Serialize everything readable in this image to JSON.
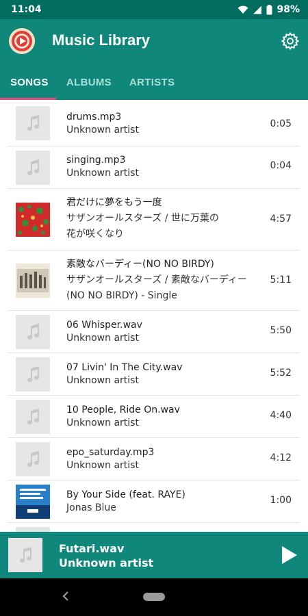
{
  "status_bar": {
    "time": "11:04",
    "battery": "98%"
  },
  "app_bar": {
    "title": "Music Library"
  },
  "tabs": [
    {
      "label": "SONGS"
    },
    {
      "label": "ALBUMS"
    },
    {
      "label": "ARTISTS"
    }
  ],
  "songs": [
    {
      "title": "drums.mp3",
      "artist": "Unknown artist",
      "duration": "0:05"
    },
    {
      "title": "singing.mp3",
      "artist": "Unknown artist",
      "duration": "0:04"
    },
    {
      "title": "君だけに夢をもう一度",
      "artist": "サザンオールスターズ / 世に万葉の",
      "artist2": "花が咲くなり",
      "duration": "4:57"
    },
    {
      "title": "素敵なバーディー(NO NO BIRDY)",
      "artist": "サザンオールスターズ / 素敵なバーディー",
      "artist2": "(NO NO BIRDY) - Single",
      "duration": "5:11"
    },
    {
      "title": "06 Whisper.wav",
      "artist": "Unknown artist",
      "duration": "5:50"
    },
    {
      "title": "07 Livin' In The City.wav",
      "artist": "Unknown artist",
      "duration": "5:52"
    },
    {
      "title": "10 People, Ride On.wav",
      "artist": "Unknown artist",
      "duration": "4:40"
    },
    {
      "title": "epo_saturday.mp3",
      "artist": "Unknown artist",
      "duration": "4:12"
    },
    {
      "title": "By Your Side (feat. RAYE)",
      "artist": "Jonas Blue",
      "duration": "1:00"
    }
  ],
  "now_playing": {
    "title": "Futari.wav",
    "artist": "Unknown artist"
  },
  "icons": {
    "status": [
      "wifi-icon",
      "signal-icon",
      "battery-icon"
    ],
    "app": "app-logo-icon",
    "settings": "gear-icon",
    "placeholder": "music-note-icon",
    "play": "play-icon",
    "back": "back-icon",
    "home": "home-pill-icon"
  },
  "colors": {
    "app_bar": "#0f877a",
    "status_bar": "#006d5f",
    "tab_indicator": "#ec4a78",
    "placeholder": "#e6e6e6"
  }
}
